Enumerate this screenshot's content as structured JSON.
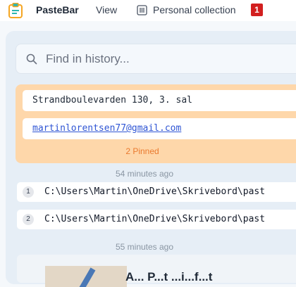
{
  "app": {
    "name": "PasteBar"
  },
  "menu": {
    "view_label": "View",
    "collection_label": "Personal collection",
    "badge": "1"
  },
  "search": {
    "placeholder": "Find in history..."
  },
  "pinned": {
    "items": [
      {
        "text": "Strandboulevarden 130, 3. sal"
      },
      {
        "text": "martinlorentsen77@gmail.com"
      }
    ],
    "label": "2 Pinned"
  },
  "history": {
    "groups": [
      {
        "time": "54 minutes ago",
        "items": [
          {
            "index": "1",
            "text": "C:\\Users\\Martin\\OneDrive\\Skrivebord\\past"
          },
          {
            "index": "2",
            "text": "C:\\Users\\Martin\\OneDrive\\Skrivebord\\past"
          }
        ]
      },
      {
        "time": "55 minutes ago"
      }
    ],
    "partial_card_text": "A... P...t ...i...f...t"
  },
  "colors": {
    "accent": "#ea7a2f",
    "pinned_bg": "#fed7aa",
    "badge": "#d21f1f",
    "link": "#2f55d4"
  },
  "icons": {
    "logo": "clipboard-icon",
    "collection": "book-icon",
    "search": "search-icon"
  }
}
